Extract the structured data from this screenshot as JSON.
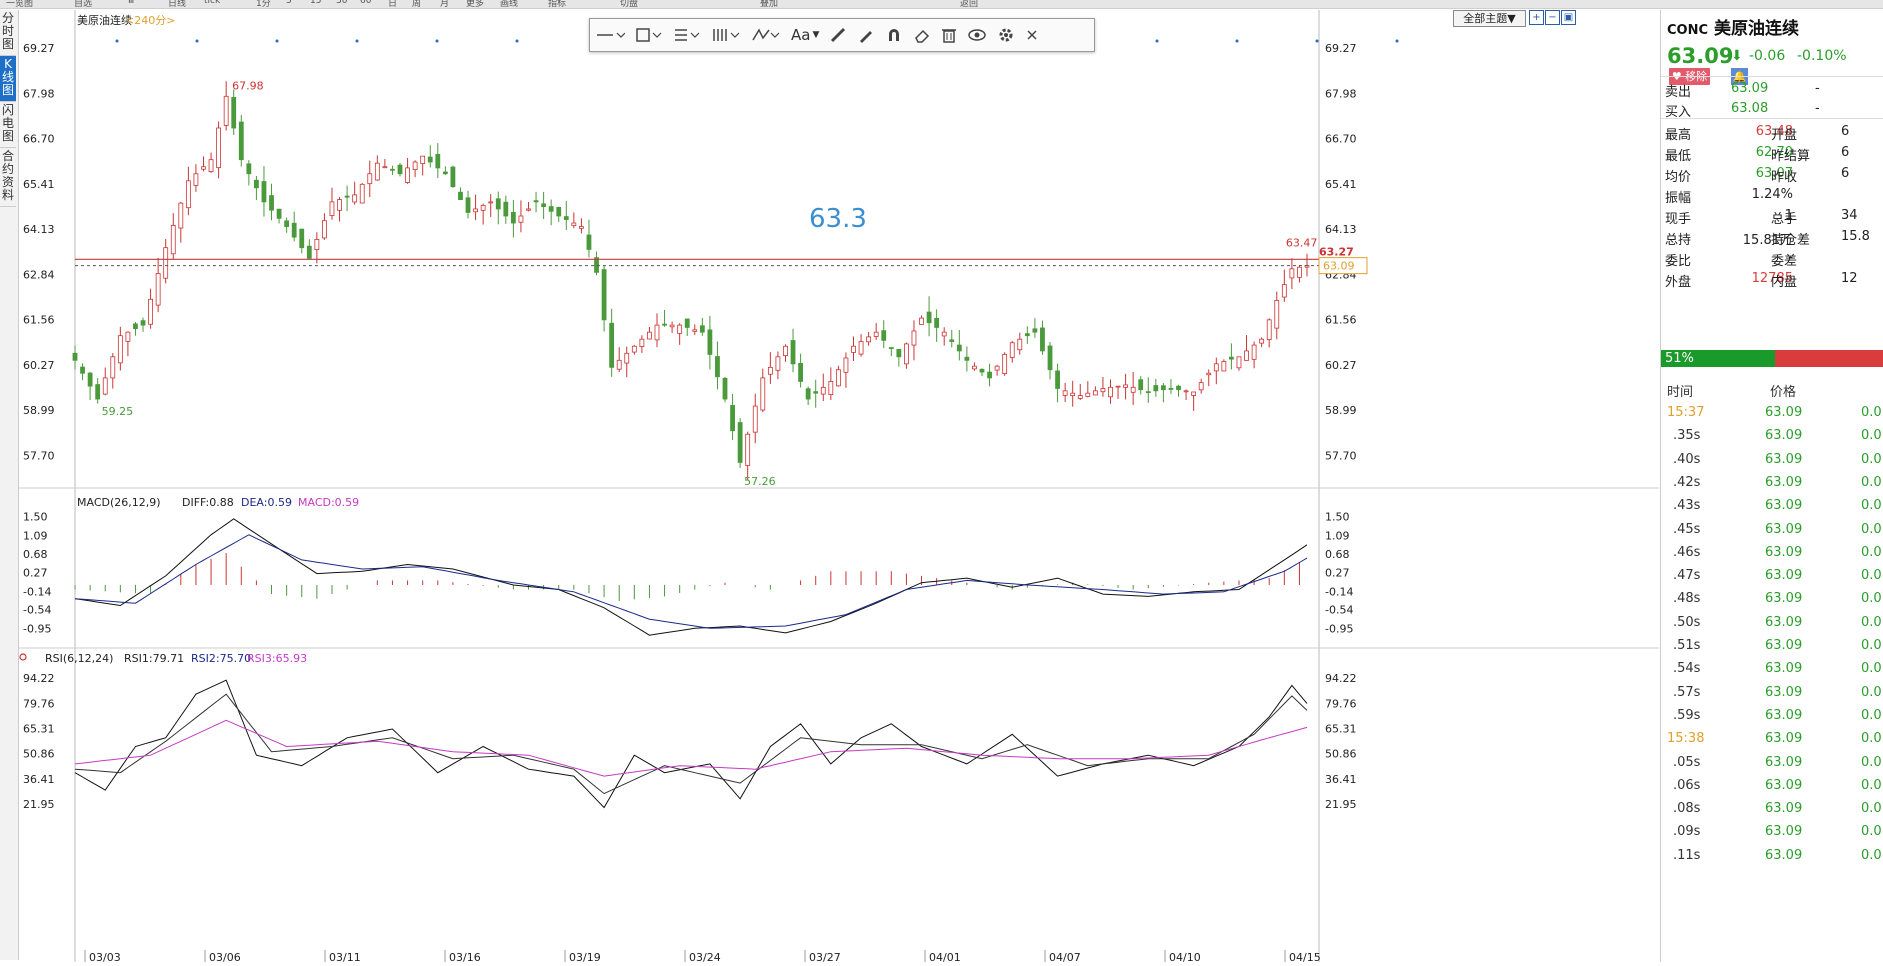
{
  "top_strip": [
    "一览图",
    "自选",
    "Ⅲ",
    "日线",
    "tick",
    "1分",
    "5",
    "15",
    "30",
    "60",
    "日",
    "周",
    "月",
    "更多",
    "画线",
    "指标",
    "切盘",
    "叠加",
    "返回"
  ],
  "left_tabs": [
    {
      "label": "分时图",
      "active": false
    },
    {
      "label": "K线图",
      "active": true
    },
    {
      "label": "闪电图",
      "active": false
    },
    {
      "label": "合约资料",
      "active": false
    }
  ],
  "chart_header": {
    "name": "美原油连续",
    "period": "<240分>"
  },
  "theme_button": "全部主题▼",
  "toolbar_icons": [
    "line-tool-icon",
    "rect-tool-icon",
    "text-tool-icon",
    "bars-tool-icon",
    "pattern-tool-icon",
    "font-tool-icon",
    "ruler-icon",
    "pen-icon",
    "magnet-icon",
    "eraser-icon",
    "trash-icon",
    "eye-icon",
    "gear-icon",
    "close-icon"
  ],
  "toolbar_font_label": "Aa",
  "drawn_label": "63.3",
  "colors": {
    "up": "#cc3333",
    "down": "#4a9a3c",
    "accent": "#1e6fc8",
    "price_green": "#2a9d2a",
    "price_red": "#d93c3c"
  },
  "chart_data": [
    {
      "type": "candlestick",
      "yticks": [
        "69.27",
        "67.98",
        "66.70",
        "65.41",
        "64.13",
        "62.84",
        "61.56",
        "60.27",
        "58.99",
        "57.70"
      ],
      "ylim": [
        57.0,
        69.5
      ],
      "xlabels": [
        "03/03",
        "03/06",
        "03/11",
        "03/16",
        "03/19",
        "03/24",
        "03/27",
        "04/01",
        "04/07",
        "04/10",
        "04/15"
      ],
      "high_marker": "67.98",
      "low_markers": [
        "59.25",
        "57.26"
      ],
      "recent_high": "63.47",
      "hline_label": "63.27",
      "last_price_tag": "63.09",
      "close_path": [
        {
          "i": 0,
          "v": 60.4
        },
        {
          "i": 3,
          "v": 59.3
        },
        {
          "i": 6,
          "v": 61.1
        },
        {
          "i": 9,
          "v": 61.4
        },
        {
          "i": 12,
          "v": 63.6
        },
        {
          "i": 15,
          "v": 65.5
        },
        {
          "i": 18,
          "v": 66.1
        },
        {
          "i": 20,
          "v": 67.9
        },
        {
          "i": 22,
          "v": 66.1
        },
        {
          "i": 25,
          "v": 64.9
        },
        {
          "i": 28,
          "v": 64.2
        },
        {
          "i": 31,
          "v": 63.3
        },
        {
          "i": 34,
          "v": 64.9
        },
        {
          "i": 37,
          "v": 65.1
        },
        {
          "i": 40,
          "v": 66.0
        },
        {
          "i": 43,
          "v": 65.7
        },
        {
          "i": 46,
          "v": 66.2
        },
        {
          "i": 49,
          "v": 65.7
        },
        {
          "i": 52,
          "v": 64.6
        },
        {
          "i": 55,
          "v": 64.9
        },
        {
          "i": 58,
          "v": 64.3
        },
        {
          "i": 61,
          "v": 64.9
        },
        {
          "i": 64,
          "v": 64.5
        },
        {
          "i": 67,
          "v": 64.2
        },
        {
          "i": 69,
          "v": 62.9
        },
        {
          "i": 71,
          "v": 60.2
        },
        {
          "i": 74,
          "v": 60.8
        },
        {
          "i": 77,
          "v": 61.4
        },
        {
          "i": 80,
          "v": 61.4
        },
        {
          "i": 83,
          "v": 61.2
        },
        {
          "i": 86,
          "v": 59.3
        },
        {
          "i": 88,
          "v": 57.5
        },
        {
          "i": 91,
          "v": 59.9
        },
        {
          "i": 94,
          "v": 60.8
        },
        {
          "i": 97,
          "v": 59.3
        },
        {
          "i": 100,
          "v": 59.8
        },
        {
          "i": 103,
          "v": 60.8
        },
        {
          "i": 106,
          "v": 61.2
        },
        {
          "i": 109,
          "v": 60.5
        },
        {
          "i": 112,
          "v": 61.6
        },
        {
          "i": 115,
          "v": 61.2
        },
        {
          "i": 118,
          "v": 60.4
        },
        {
          "i": 121,
          "v": 59.9
        },
        {
          "i": 124,
          "v": 60.9
        },
        {
          "i": 127,
          "v": 61.2
        },
        {
          "i": 130,
          "v": 59.6
        },
        {
          "i": 133,
          "v": 59.4
        },
        {
          "i": 136,
          "v": 59.6
        },
        {
          "i": 139,
          "v": 59.7
        },
        {
          "i": 142,
          "v": 59.5
        },
        {
          "i": 145,
          "v": 59.6
        },
        {
          "i": 148,
          "v": 59.5
        },
        {
          "i": 151,
          "v": 60.3
        },
        {
          "i": 154,
          "v": 60.5
        },
        {
          "i": 157,
          "v": 61.0
        },
        {
          "i": 159,
          "v": 62.1
        },
        {
          "i": 161,
          "v": 63.0
        },
        {
          "i": 163,
          "v": 63.09
        }
      ],
      "current_line": 63.27,
      "dashed_line": 63.09
    },
    {
      "type": "macd",
      "title": "MACD(26,12,9)",
      "diff_label": "DIFF:0.88",
      "dea_label": "DEA:0.59",
      "macd_label": "MACD:0.59",
      "yticks": [
        "1.50",
        "1.09",
        "0.68",
        "0.27",
        "-0.14",
        "-0.54",
        "-0.95"
      ],
      "ylim": [
        -1.25,
        1.6
      ],
      "diff": [
        {
          "i": 0,
          "v": -0.3
        },
        {
          "i": 6,
          "v": -0.45
        },
        {
          "i": 12,
          "v": 0.2
        },
        {
          "i": 18,
          "v": 1.1
        },
        {
          "i": 21,
          "v": 1.45
        },
        {
          "i": 26,
          "v": 0.9
        },
        {
          "i": 32,
          "v": 0.25
        },
        {
          "i": 38,
          "v": 0.3
        },
        {
          "i": 44,
          "v": 0.45
        },
        {
          "i": 50,
          "v": 0.35
        },
        {
          "i": 58,
          "v": 0.0
        },
        {
          "i": 64,
          "v": -0.1
        },
        {
          "i": 70,
          "v": -0.5
        },
        {
          "i": 76,
          "v": -1.1
        },
        {
          "i": 82,
          "v": -0.95
        },
        {
          "i": 88,
          "v": -0.9
        },
        {
          "i": 94,
          "v": -1.05
        },
        {
          "i": 100,
          "v": -0.8
        },
        {
          "i": 106,
          "v": -0.4
        },
        {
          "i": 112,
          "v": 0.05
        },
        {
          "i": 118,
          "v": 0.15
        },
        {
          "i": 124,
          "v": -0.05
        },
        {
          "i": 130,
          "v": 0.15
        },
        {
          "i": 136,
          "v": -0.2
        },
        {
          "i": 142,
          "v": -0.25
        },
        {
          "i": 148,
          "v": -0.15
        },
        {
          "i": 154,
          "v": -0.1
        },
        {
          "i": 160,
          "v": 0.55
        },
        {
          "i": 163,
          "v": 0.88
        }
      ],
      "dea": [
        {
          "i": 0,
          "v": -0.3
        },
        {
          "i": 8,
          "v": -0.4
        },
        {
          "i": 16,
          "v": 0.45
        },
        {
          "i": 23,
          "v": 1.1
        },
        {
          "i": 30,
          "v": 0.55
        },
        {
          "i": 38,
          "v": 0.35
        },
        {
          "i": 46,
          "v": 0.4
        },
        {
          "i": 56,
          "v": 0.1
        },
        {
          "i": 66,
          "v": -0.15
        },
        {
          "i": 76,
          "v": -0.75
        },
        {
          "i": 84,
          "v": -0.95
        },
        {
          "i": 94,
          "v": -0.9
        },
        {
          "i": 102,
          "v": -0.65
        },
        {
          "i": 110,
          "v": -0.1
        },
        {
          "i": 118,
          "v": 0.1
        },
        {
          "i": 126,
          "v": 0.0
        },
        {
          "i": 136,
          "v": -0.1
        },
        {
          "i": 144,
          "v": -0.2
        },
        {
          "i": 152,
          "v": -0.15
        },
        {
          "i": 160,
          "v": 0.3
        },
        {
          "i": 163,
          "v": 0.59
        }
      ],
      "macd_bars": [
        {
          "i": 0,
          "v": -0.1
        },
        {
          "i": 10,
          "v": -0.2
        },
        {
          "i": 16,
          "v": 0.45
        },
        {
          "i": 20,
          "v": 0.7
        },
        {
          "i": 26,
          "v": -0.2
        },
        {
          "i": 32,
          "v": -0.3
        },
        {
          "i": 40,
          "v": 0.1
        },
        {
          "i": 48,
          "v": 0.1
        },
        {
          "i": 58,
          "v": -0.1
        },
        {
          "i": 66,
          "v": -0.1
        },
        {
          "i": 72,
          "v": -0.35
        },
        {
          "i": 78,
          "v": -0.25
        },
        {
          "i": 86,
          "v": 0.05
        },
        {
          "i": 92,
          "v": -0.1
        },
        {
          "i": 100,
          "v": 0.3
        },
        {
          "i": 108,
          "v": 0.3
        },
        {
          "i": 116,
          "v": 0.1
        },
        {
          "i": 124,
          "v": -0.1
        },
        {
          "i": 132,
          "v": 0.05
        },
        {
          "i": 140,
          "v": -0.1
        },
        {
          "i": 150,
          "v": 0.05
        },
        {
          "i": 158,
          "v": 0.15
        },
        {
          "i": 163,
          "v": 0.59
        }
      ]
    },
    {
      "type": "rsi",
      "title": "RSI(6,12,24)",
      "rsi1_label": "RSI1:79.71",
      "rsi2_label": "RSI2:75.70",
      "rsi3_label": "RSI3:65.93",
      "yticks": [
        "94.22",
        "79.76",
        "65.31",
        "50.86",
        "36.41",
        "21.95"
      ],
      "ylim": [
        14,
        100
      ],
      "rsi1": [
        {
          "i": 0,
          "v": 40
        },
        {
          "i": 4,
          "v": 30
        },
        {
          "i": 8,
          "v": 55
        },
        {
          "i": 12,
          "v": 60
        },
        {
          "i": 16,
          "v": 85
        },
        {
          "i": 20,
          "v": 93
        },
        {
          "i": 24,
          "v": 50
        },
        {
          "i": 30,
          "v": 44
        },
        {
          "i": 36,
          "v": 60
        },
        {
          "i": 42,
          "v": 65
        },
        {
          "i": 48,
          "v": 40
        },
        {
          "i": 54,
          "v": 55
        },
        {
          "i": 60,
          "v": 42
        },
        {
          "i": 66,
          "v": 38
        },
        {
          "i": 70,
          "v": 20
        },
        {
          "i": 74,
          "v": 50
        },
        {
          "i": 78,
          "v": 40
        },
        {
          "i": 84,
          "v": 45
        },
        {
          "i": 88,
          "v": 25
        },
        {
          "i": 92,
          "v": 55
        },
        {
          "i": 96,
          "v": 68
        },
        {
          "i": 100,
          "v": 45
        },
        {
          "i": 104,
          "v": 60
        },
        {
          "i": 108,
          "v": 68
        },
        {
          "i": 112,
          "v": 55
        },
        {
          "i": 118,
          "v": 45
        },
        {
          "i": 124,
          "v": 62
        },
        {
          "i": 130,
          "v": 38
        },
        {
          "i": 136,
          "v": 45
        },
        {
          "i": 142,
          "v": 50
        },
        {
          "i": 148,
          "v": 44
        },
        {
          "i": 154,
          "v": 55
        },
        {
          "i": 158,
          "v": 72
        },
        {
          "i": 161,
          "v": 90
        },
        {
          "i": 163,
          "v": 79.71
        }
      ],
      "rsi2": [
        {
          "i": 0,
          "v": 42
        },
        {
          "i": 6,
          "v": 40
        },
        {
          "i": 12,
          "v": 58
        },
        {
          "i": 20,
          "v": 85
        },
        {
          "i": 26,
          "v": 52
        },
        {
          "i": 34,
          "v": 55
        },
        {
          "i": 42,
          "v": 60
        },
        {
          "i": 50,
          "v": 48
        },
        {
          "i": 58,
          "v": 50
        },
        {
          "i": 66,
          "v": 42
        },
        {
          "i": 70,
          "v": 28
        },
        {
          "i": 78,
          "v": 44
        },
        {
          "i": 88,
          "v": 34
        },
        {
          "i": 96,
          "v": 60
        },
        {
          "i": 104,
          "v": 56
        },
        {
          "i": 112,
          "v": 56
        },
        {
          "i": 120,
          "v": 48
        },
        {
          "i": 126,
          "v": 56
        },
        {
          "i": 134,
          "v": 44
        },
        {
          "i": 142,
          "v": 48
        },
        {
          "i": 150,
          "v": 48
        },
        {
          "i": 156,
          "v": 62
        },
        {
          "i": 161,
          "v": 84
        },
        {
          "i": 163,
          "v": 75.7
        }
      ],
      "rsi3": [
        {
          "i": 0,
          "v": 45
        },
        {
          "i": 10,
          "v": 50
        },
        {
          "i": 20,
          "v": 70
        },
        {
          "i": 28,
          "v": 55
        },
        {
          "i": 40,
          "v": 58
        },
        {
          "i": 50,
          "v": 52
        },
        {
          "i": 60,
          "v": 50
        },
        {
          "i": 70,
          "v": 38
        },
        {
          "i": 80,
          "v": 44
        },
        {
          "i": 90,
          "v": 42
        },
        {
          "i": 100,
          "v": 52
        },
        {
          "i": 110,
          "v": 54
        },
        {
          "i": 120,
          "v": 50
        },
        {
          "i": 130,
          "v": 48
        },
        {
          "i": 140,
          "v": 48
        },
        {
          "i": 150,
          "v": 50
        },
        {
          "i": 158,
          "v": 60
        },
        {
          "i": 163,
          "v": 65.93
        }
      ]
    }
  ],
  "panel": {
    "code": "CONC",
    "name": "美原油连续",
    "price": "63.09",
    "change": "-0.06",
    "change_pct": "-0.10%",
    "remove_label": "移除",
    "quotes": [
      {
        "l1": "卖出",
        "v1": "63.09",
        "l2": "",
        "v2": "-"
      },
      {
        "l1": "买入",
        "v1": "63.08",
        "l2": "",
        "v2": "-"
      }
    ],
    "stats": [
      {
        "l1": "最高",
        "v1": "63.48",
        "c1": "red",
        "l2": "开盘",
        "v2": "6"
      },
      {
        "l1": "最低",
        "v1": "62.70",
        "c1": "green",
        "l2": "昨结算",
        "v2": "6"
      },
      {
        "l1": "均价",
        "v1": "63.07",
        "c1": "green",
        "l2": "昨收",
        "v2": "6"
      },
      {
        "l1": "振幅",
        "v1": "1.24%",
        "c1": "black",
        "l2": "",
        "v2": ""
      },
      {
        "l1": "现手",
        "v1": "1",
        "c1": "black",
        "l2": "总手",
        "v2": "34"
      },
      {
        "l1": "总持",
        "v1": "15.81万",
        "c1": "black",
        "l2": "持仓差",
        "v2": "15.8"
      },
      {
        "l1": "委比",
        "v1": "-",
        "c1": "black",
        "l2": "委差",
        "v2": ""
      },
      {
        "l1": "外盘",
        "v1": "12785",
        "c1": "red",
        "l2": "内盘",
        "v2": "12"
      }
    ],
    "ratio": "51%",
    "ratio_value": 0.51,
    "ticks_header": {
      "time": "时间",
      "price": "价格"
    },
    "ticks": [
      {
        "t": "15:37",
        "p": "63.09",
        "v": "0.0",
        "hl": true
      },
      {
        "t": ".35s",
        "p": "63.09",
        "v": "0.0",
        "hl": false
      },
      {
        "t": ".40s",
        "p": "63.09",
        "v": "0.0",
        "hl": false
      },
      {
        "t": ".42s",
        "p": "63.09",
        "v": "0.0",
        "hl": false
      },
      {
        "t": ".43s",
        "p": "63.09",
        "v": "0.0",
        "hl": false
      },
      {
        "t": ".45s",
        "p": "63.09",
        "v": "0.0",
        "hl": false
      },
      {
        "t": ".46s",
        "p": "63.09",
        "v": "0.0",
        "hl": false
      },
      {
        "t": ".47s",
        "p": "63.09",
        "v": "0.0",
        "hl": false
      },
      {
        "t": ".48s",
        "p": "63.09",
        "v": "0.0",
        "hl": false
      },
      {
        "t": ".50s",
        "p": "63.09",
        "v": "0.0",
        "hl": false
      },
      {
        "t": ".51s",
        "p": "63.09",
        "v": "0.0",
        "hl": false
      },
      {
        "t": ".54s",
        "p": "63.09",
        "v": "0.0",
        "hl": false
      },
      {
        "t": ".57s",
        "p": "63.09",
        "v": "0.0",
        "hl": false
      },
      {
        "t": ".59s",
        "p": "63.09",
        "v": "0.0",
        "hl": false
      },
      {
        "t": "15:38",
        "p": "63.09",
        "v": "0.0",
        "hl": true
      },
      {
        "t": ".05s",
        "p": "63.09",
        "v": "0.0",
        "hl": false
      },
      {
        "t": ".06s",
        "p": "63.09",
        "v": "0.0",
        "hl": false
      },
      {
        "t": ".08s",
        "p": "63.09",
        "v": "0.0",
        "hl": false
      },
      {
        "t": ".09s",
        "p": "63.09",
        "v": "0.0",
        "hl": false
      },
      {
        "t": ".11s",
        "p": "63.09",
        "v": "0.0",
        "hl": false
      }
    ]
  }
}
